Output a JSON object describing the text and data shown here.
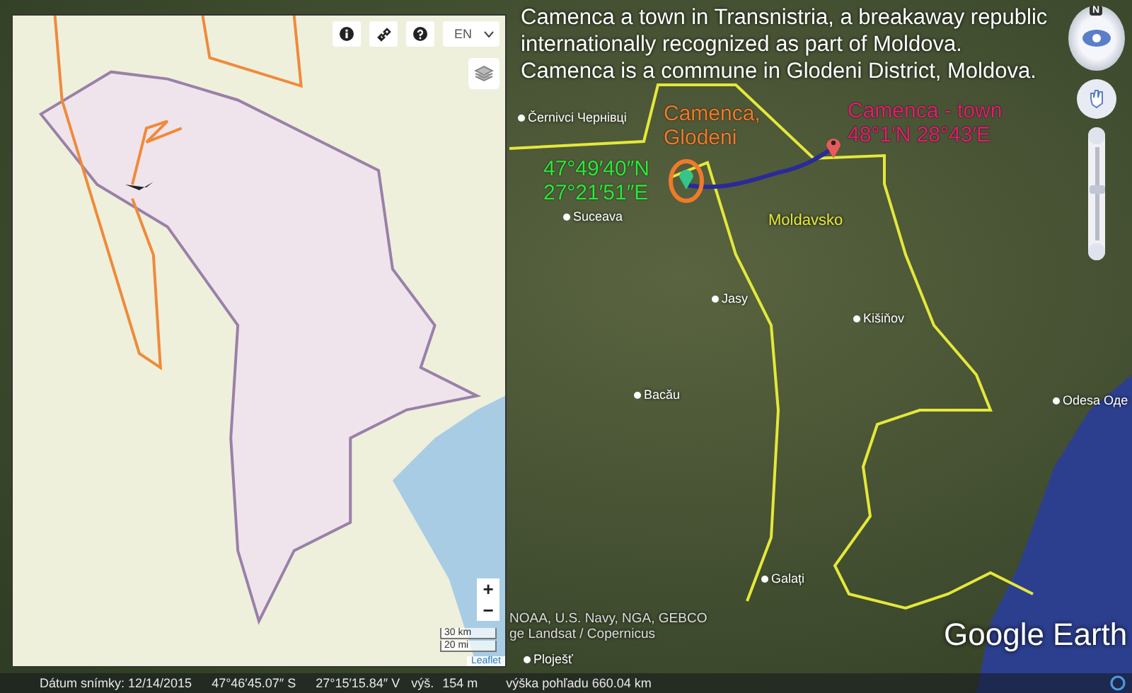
{
  "map_panel": {
    "language": "EN",
    "zoom_in": "+",
    "zoom_out": "−",
    "scale": [
      "30 km",
      "20 mi"
    ],
    "attribution": "Leaflet"
  },
  "caption": [
    "Camenca a town in Transnistria, a breakaway republic",
    "internationally recognized as part of Moldova.",
    "Camenca is a commune in Glodeni District, Moldova."
  ],
  "place_labels": [
    "Černivci Чернівці",
    "Suceava",
    "Jasy",
    "Kišiňov",
    "Bacău",
    "Odesa Оде",
    "Galați",
    "Ploješť"
  ],
  "region_label": "Moldavsko",
  "annotations": [
    {
      "lines": [
        "Camenca,",
        "Glodeni"
      ],
      "color": "#f07a2a"
    },
    {
      "lines": [
        "47°49′40″N",
        "27°21′51″E"
      ],
      "color": "#2ee83a"
    },
    {
      "lines": [
        "Camenca - town",
        "48°1′N 28°43′E"
      ],
      "color": "#e0206e"
    }
  ],
  "compass": {
    "label": "N"
  },
  "zoom_slider": {
    "level": 0.55
  },
  "imagery_credit": [
    "NOAA, U.S. Navy, NGA, GEBCO",
    "ge Landsat / Copernicus"
  ],
  "logo": "Google Earth",
  "status_bar": [
    "Dátum snímky: 12/14/2015",
    "47°46′45.07″ S",
    "27°15′15.84″ V",
    "výš.",
    "154 m",
    "výška pohľadu 660.04 km"
  ]
}
